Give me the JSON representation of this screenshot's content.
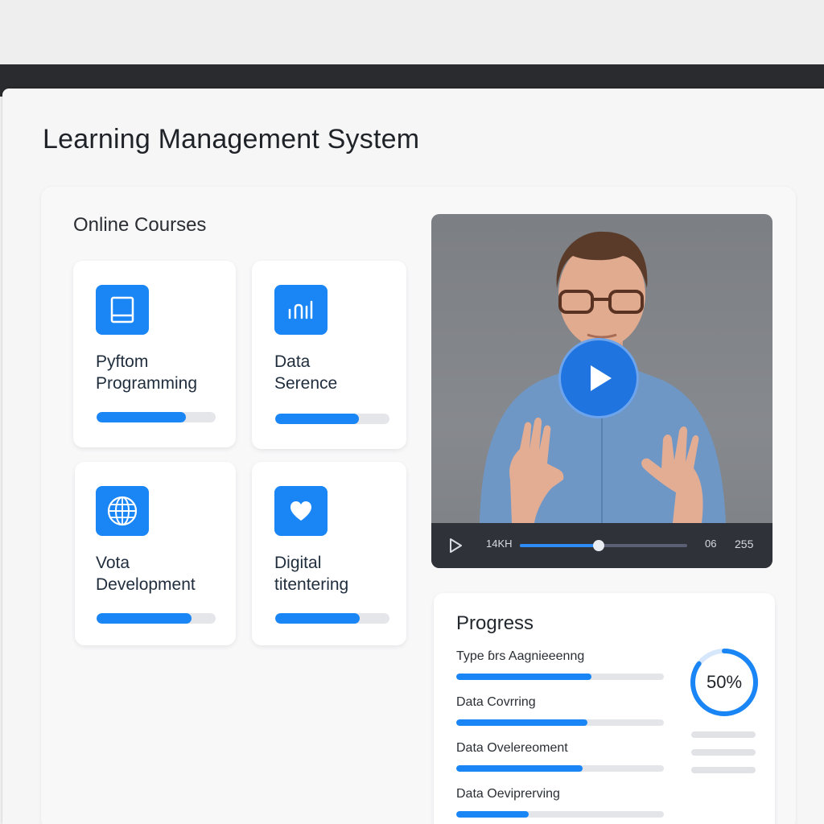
{
  "app": {
    "title": "Learning Management System"
  },
  "courses": {
    "section_title": "Online Courses",
    "items": [
      {
        "line1": "Pyftom",
        "line2": "Programming",
        "icon": "book-icon",
        "progress": 0.75
      },
      {
        "line1": "Data",
        "line2": "Serence",
        "icon": "chart-icon",
        "progress": 0.73
      },
      {
        "line1": "Vota",
        "line2": "Development",
        "icon": "globe-icon",
        "progress": 0.8
      },
      {
        "line1": "Digital",
        "line2": "titentering",
        "icon": "heart-icon",
        "progress": 0.74
      }
    ]
  },
  "video": {
    "time_left": "14KH",
    "time_mid": "06",
    "time_right": "255",
    "seek_progress": 0.47
  },
  "progress": {
    "title": "Progress",
    "items": [
      {
        "label": "Type ɓrs Aagnieeenng",
        "value": 0.65
      },
      {
        "label": "Data Covrring",
        "value": 0.63
      },
      {
        "label": "Data Ovelereoment",
        "value": 0.61
      },
      {
        "label": "Data Oeviprerving",
        "value": 0.35
      }
    ],
    "donut_label": "50%",
    "donut_value": 0.85
  },
  "colors": {
    "accent": "#1a86f5",
    "track": "#e4e6ea",
    "video_bar": "#2f3238"
  }
}
